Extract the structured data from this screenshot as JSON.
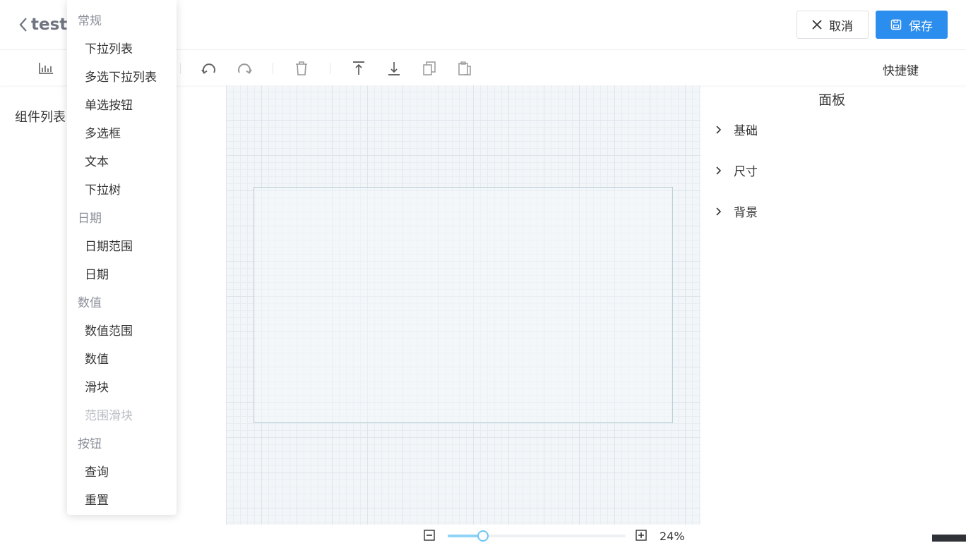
{
  "header": {
    "back_label": "test",
    "cancel_label": "取消",
    "save_label": "保存"
  },
  "toolbar": {
    "icons": [
      "chart-icon",
      "undo-icon",
      "redo-icon",
      "delete-icon",
      "move-top-icon",
      "move-bottom-icon",
      "copy-icon",
      "paste-icon"
    ],
    "shortcut_label": "快捷键"
  },
  "left_panel": {
    "title": "组件列表"
  },
  "menu": {
    "groups": [
      {
        "label": "常规",
        "items": [
          "下拉列表",
          "多选下拉列表",
          "单选按钮",
          "多选框",
          "文本",
          "下拉树"
        ]
      },
      {
        "label": "日期",
        "items": [
          "日期范围",
          "日期"
        ]
      },
      {
        "label": "数值",
        "items": [
          "数值范围",
          "数值",
          "滑块",
          "范围滑块"
        ]
      },
      {
        "label": "按钮",
        "items": [
          "查询",
          "重置"
        ]
      }
    ],
    "disabled_items": [
      "范围滑块"
    ]
  },
  "right_panel": {
    "title": "面板",
    "sections": [
      "基础",
      "尺寸",
      "背景"
    ]
  },
  "zoom": {
    "value_label": "24%",
    "level": 0.24
  },
  "colors": {
    "primary": "#2b8ded",
    "slider": "#8fd3f7"
  }
}
